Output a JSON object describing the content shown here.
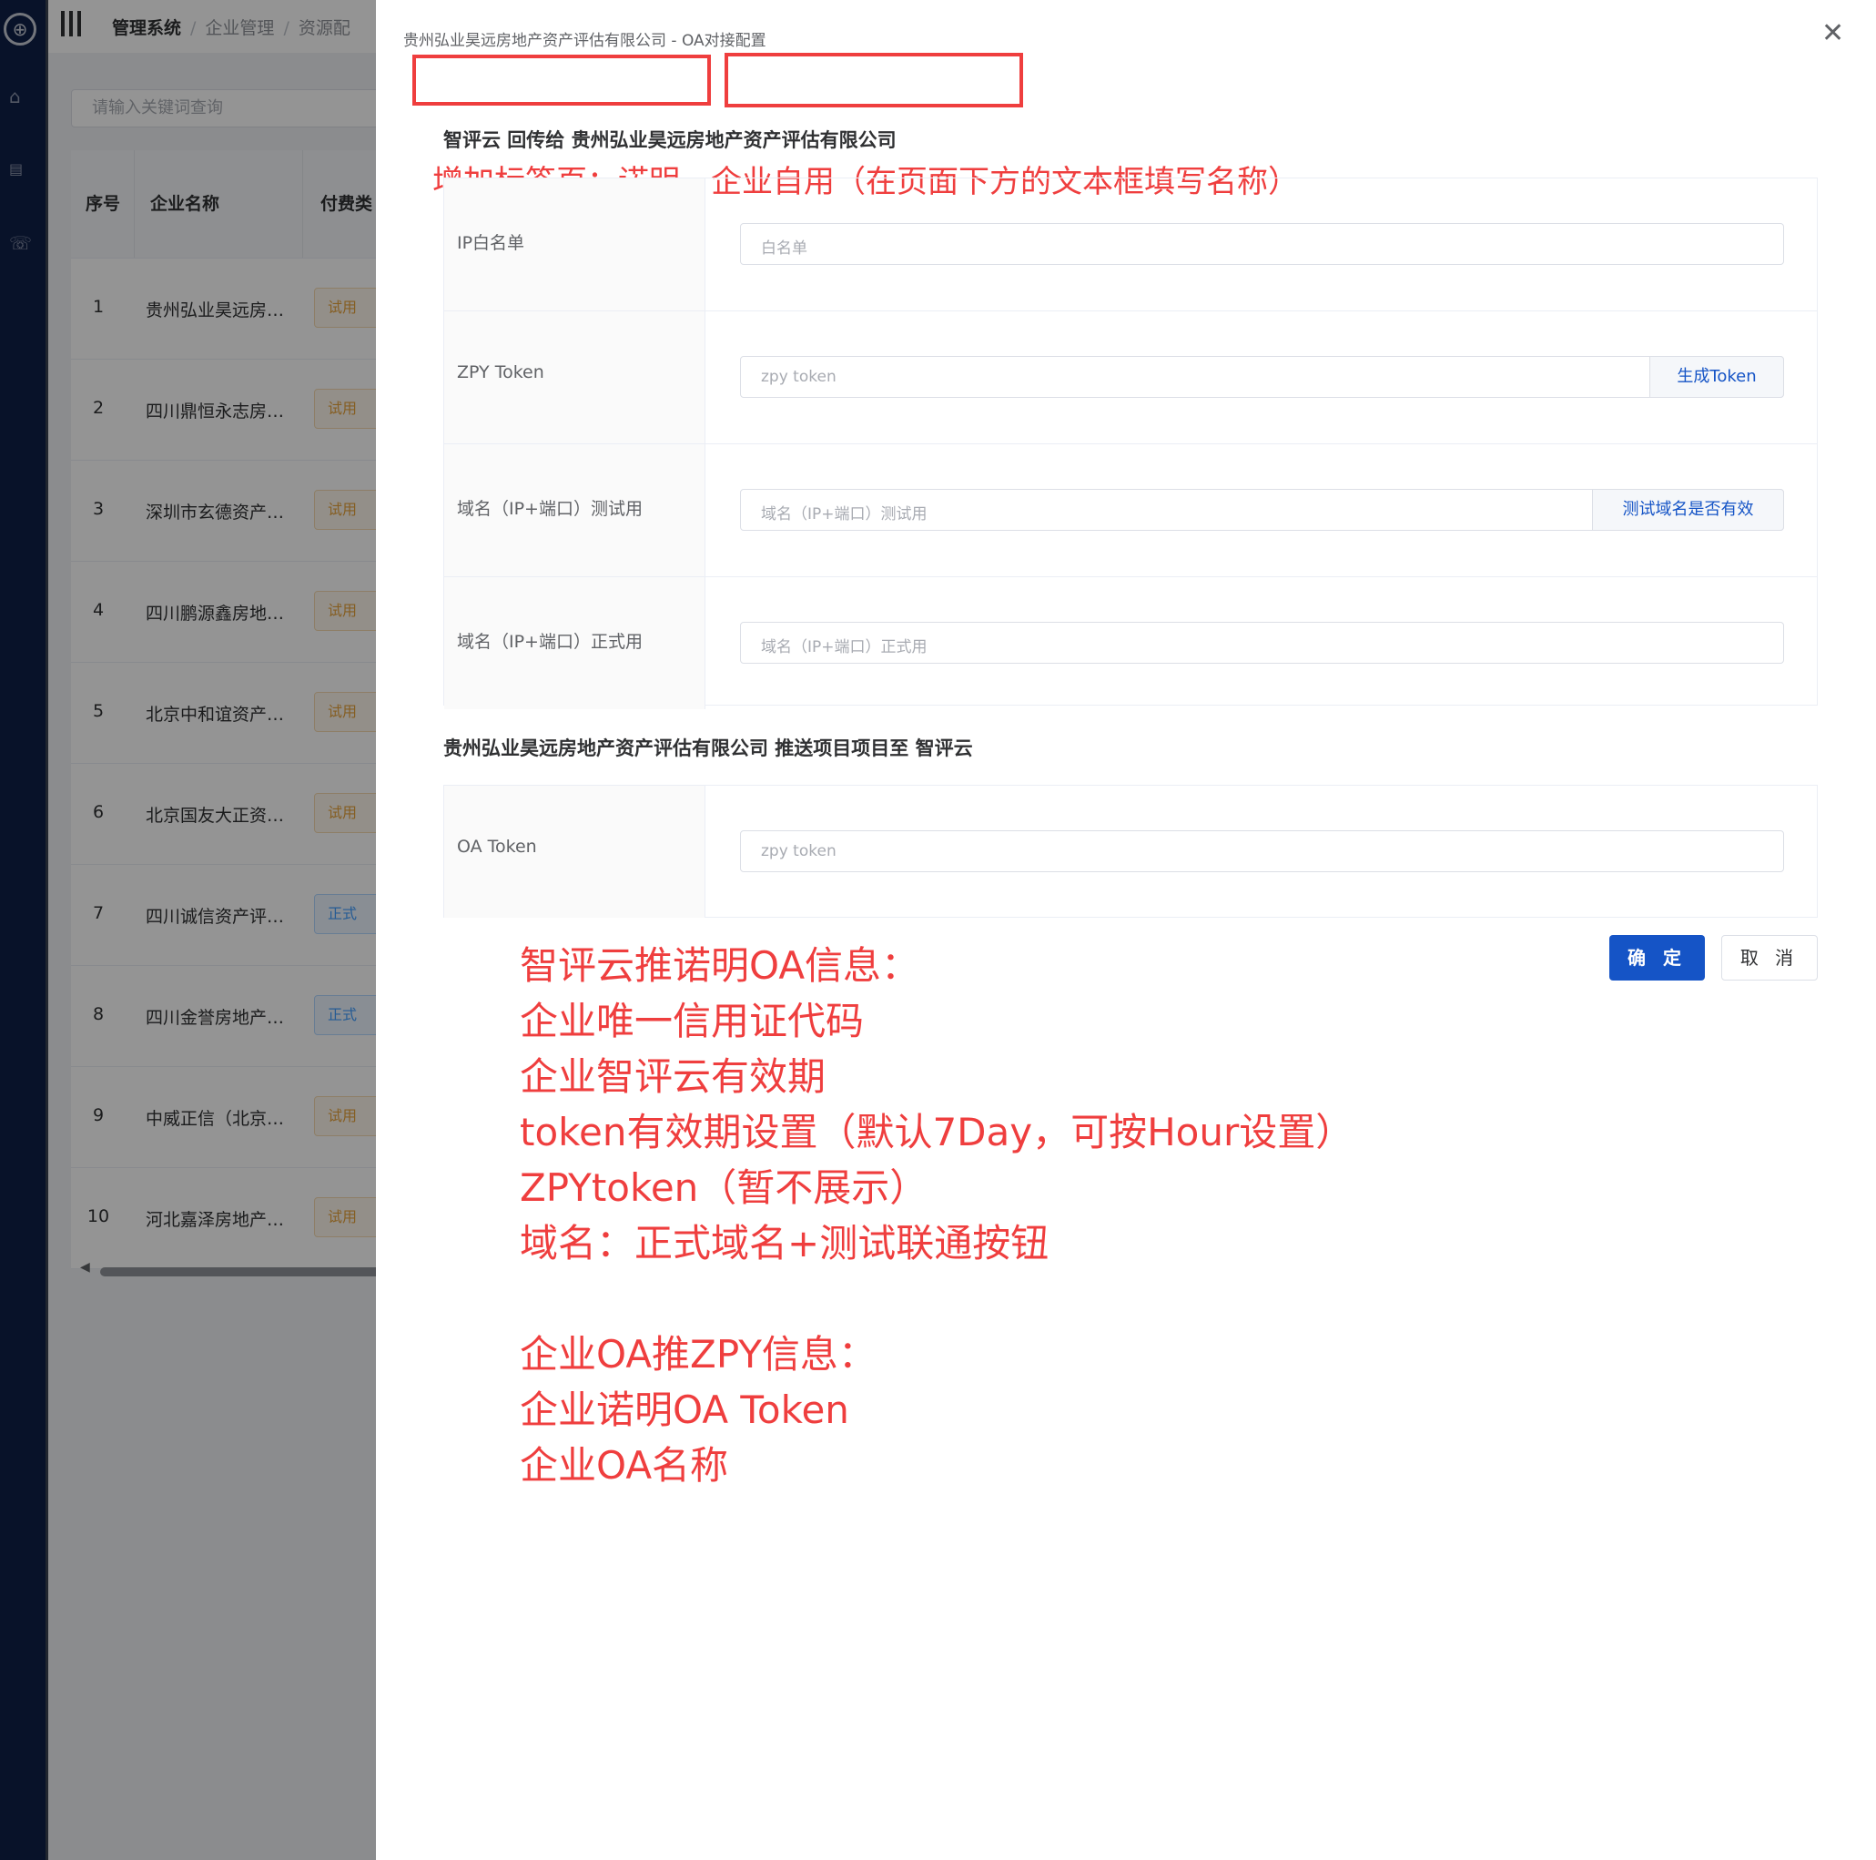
{
  "topbar": {
    "breadcrumbs": [
      "管理系统",
      "企业管理",
      "资源配"
    ]
  },
  "search": {
    "placeholder": "请输入关键词查询"
  },
  "table": {
    "headers": [
      "序号",
      "企业名称",
      "付费类"
    ],
    "rows": [
      {
        "index": "1",
        "name": "贵州弘业昊远房…",
        "tag": "试用",
        "tag_type": "trial"
      },
      {
        "index": "2",
        "name": "四川鼎恒永志房…",
        "tag": "试用",
        "tag_type": "trial"
      },
      {
        "index": "3",
        "name": "深圳市玄德资产…",
        "tag": "试用",
        "tag_type": "trial"
      },
      {
        "index": "4",
        "name": "四川鹏源鑫房地…",
        "tag": "试用",
        "tag_type": "trial"
      },
      {
        "index": "5",
        "name": "北京中和谊资产…",
        "tag": "试用",
        "tag_type": "trial"
      },
      {
        "index": "6",
        "name": "北京国友大正资…",
        "tag": "试用",
        "tag_type": "trial"
      },
      {
        "index": "7",
        "name": "四川诚信资产评…",
        "tag": "正式",
        "tag_type": "formal"
      },
      {
        "index": "8",
        "name": "四川金誉房地产…",
        "tag": "正式",
        "tag_type": "formal"
      },
      {
        "index": "9",
        "name": "中威正信（北京…",
        "tag": "试用",
        "tag_type": "trial"
      },
      {
        "index": "10",
        "name": "河北嘉泽房地产…",
        "tag": "试用",
        "tag_type": "trial"
      }
    ]
  },
  "drawer": {
    "title": "贵州弘业昊远房地产资产评估有限公司 - OA对接配置",
    "section1_title": "智评云 回传给 贵州弘业昊远房地产资产评估有限公司",
    "section2_title": "贵州弘业昊远房地产资产评估有限公司 推送项目项目至 智评云",
    "fields": {
      "ip_whitelist": {
        "label": "IP白名单",
        "placeholder": "白名单"
      },
      "zpy_token": {
        "label": "ZPY Token",
        "placeholder": "zpy token",
        "button": "生成Token"
      },
      "domain_test": {
        "label": "域名（IP+端口）测试用",
        "placeholder": "域名（IP+端口）测试用",
        "button": "测试域名是否有效"
      },
      "domain_prod": {
        "label": "域名（IP+端口）正式用",
        "placeholder": "域名（IP+端口）正式用"
      },
      "oa_token": {
        "label": "OA Token",
        "placeholder": "zpy token"
      }
    },
    "confirm_label": "确 定",
    "cancel_label": "取 消"
  },
  "annotations": {
    "tabs_note": "增加标签页：诺明、企业自用（在页面下方的文本框填写名称）",
    "notes_1": [
      "智评云推诺明OA信息：",
      "企业唯一信用证代码",
      "企业智评云有效期",
      "token有效期设置（默认7Day，可按Hour设置）",
      "ZPYtoken（暂不展示）",
      "域名：正式域名+测试联通按钮"
    ],
    "notes_2": [
      "企业OA推ZPY信息：",
      "企业诺明OA Token",
      "企业OA名称"
    ]
  },
  "colors": {
    "nav_bg": "#0f1f47",
    "primary": "#1554c6",
    "annotation_red": "#ef3e3e",
    "tag_trial": "#e6a23c",
    "tag_formal": "#409eff"
  },
  "icons": [
    "logo-icon",
    "home-icon",
    "document-icon",
    "phone-icon",
    "menu-icon",
    "close-icon",
    "scroll-left-icon"
  ]
}
